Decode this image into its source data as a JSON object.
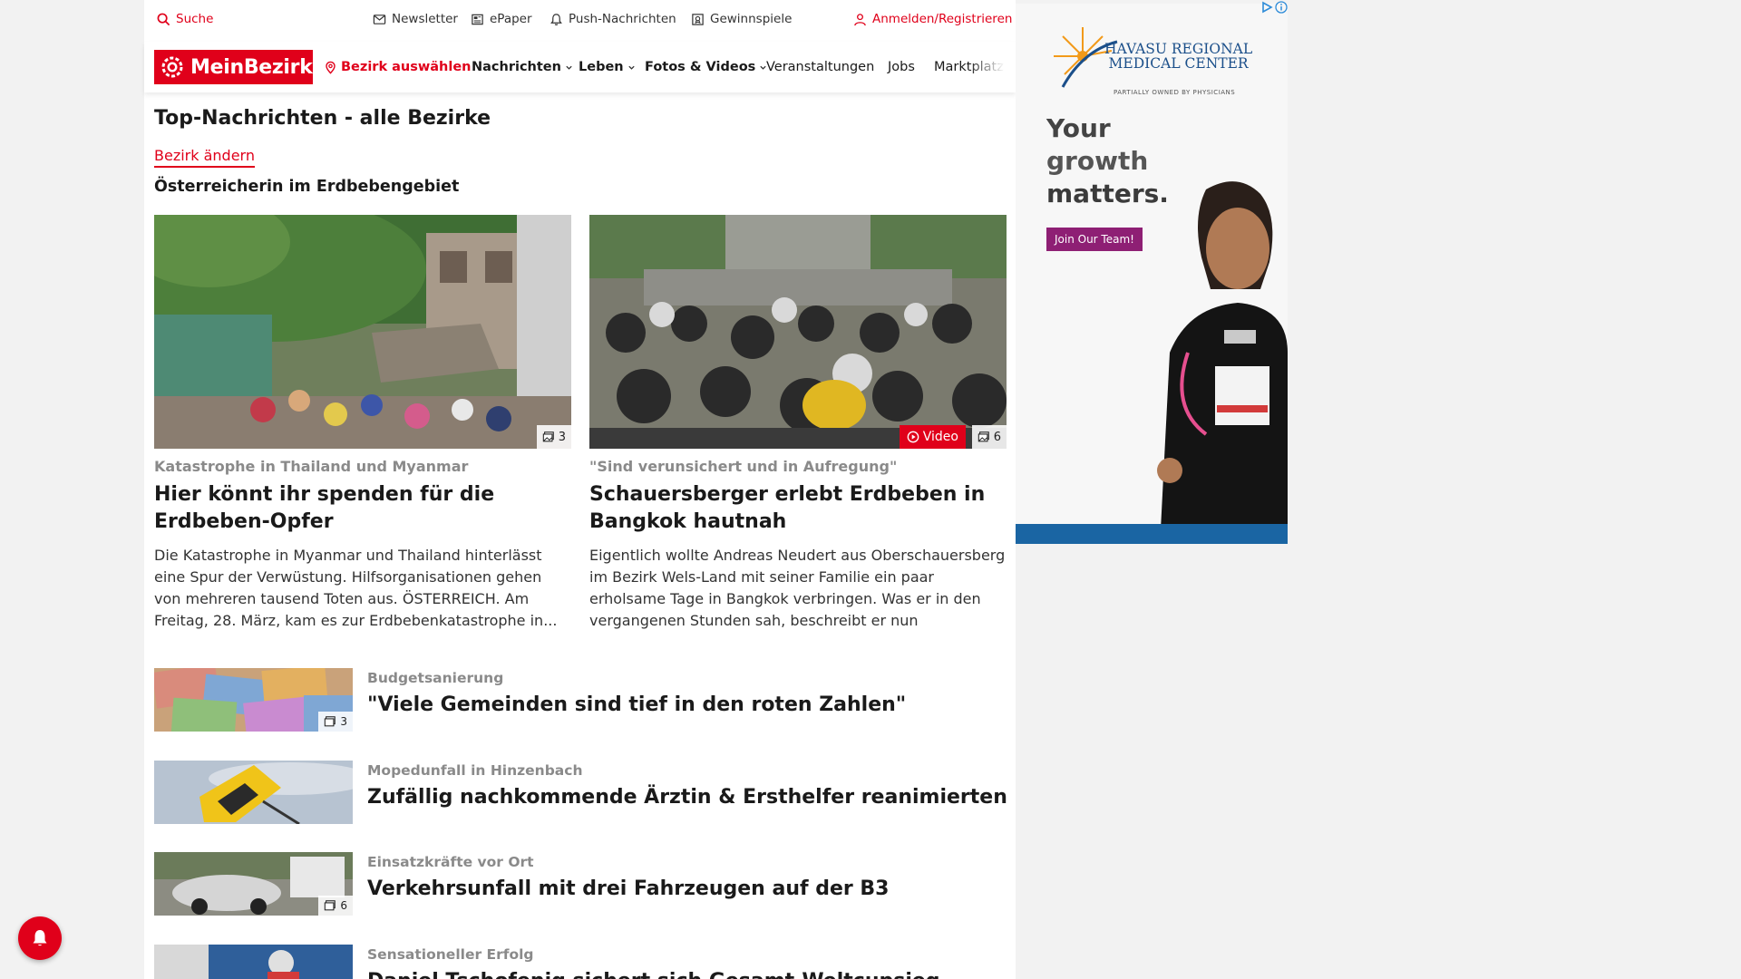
{
  "utility": {
    "search": "Suche",
    "newsletter": "Newsletter",
    "epaper": "ePaper",
    "push": "Push-Nachrichten",
    "gewinnspiele": "Gewinnspiele",
    "login": "Anmelden/Registrieren"
  },
  "nav": {
    "logo": "MeinBezirk",
    "bezirk": "Bezirk auswählen",
    "items": [
      "Nachrichten",
      "Leben",
      "Fotos & Videos",
      "Veranstaltungen",
      "Jobs",
      "Marktplatz"
    ]
  },
  "page_title": "Top-Nachrichten - alle Bezirke",
  "bezirk_link": "Bezirk ändern",
  "section_head": "Österreicherin im Erdbebengebiet",
  "cards": [
    {
      "kicker": "Katastrophe in Thailand und Myanmar",
      "title": "Hier könnt ihr spenden für die Erdbeben-Opfer",
      "text": "Die Katastrophe in Myanmar und Thailand hinterlässt eine Spur der Verwüstung. Hilfsorganisationen gehen von mehreren tausend Toten aus.  ÖSTERREICH. Am Freitag, 28. März, kam es zur Erdbebenkatastrophe in...",
      "photo_count": "3"
    },
    {
      "kicker": "\"Sind verunsichert und in Aufregung\"",
      "title": "Schauersberger erlebt Erdbeben in Bangkok hautnah",
      "text": "Eigentlich wollte Andreas Neudert aus Oberschauersberg im Bezirk Wels-Land mit seiner Familie ein paar erholsame Tage in Bangkok verbringen. Was er in den vergangenen Stunden sah, beschreibt er nun MeinBezirk...",
      "video_label": "Video",
      "photo_count": "6"
    }
  ],
  "list": [
    {
      "kicker": "Budgetsanierung",
      "title": "\"Viele Gemeinden sind tief in den roten Zahlen\"",
      "photo_count": "3"
    },
    {
      "kicker": "Mopedunfall in Hinzenbach",
      "title": "Zufällig nachkommende Ärztin & Ersthelfer reanimierten"
    },
    {
      "kicker": "Einsatzkräfte vor Ort",
      "title": "Verkehrsunfall mit drei Fahrzeugen auf der B3",
      "photo_count": "6"
    },
    {
      "kicker": "Sensationeller Erfolg",
      "title": "Daniel Tschofenig sichert sich Gesamt-Weltcupsieg"
    }
  ],
  "ad": {
    "hospital_line1": "HAVASU REGIONAL",
    "hospital_line2": "MEDICAL CENTER",
    "hospital_sub": "PARTIALLY OWNED BY PHYSICIANS",
    "headline": [
      "Your",
      "growth",
      "matters."
    ],
    "button": "Join Our Team!"
  },
  "colors": {
    "brand": "#e0001a",
    "ad_button": "#8e1f74",
    "ad_footer": "#1a65a3"
  }
}
